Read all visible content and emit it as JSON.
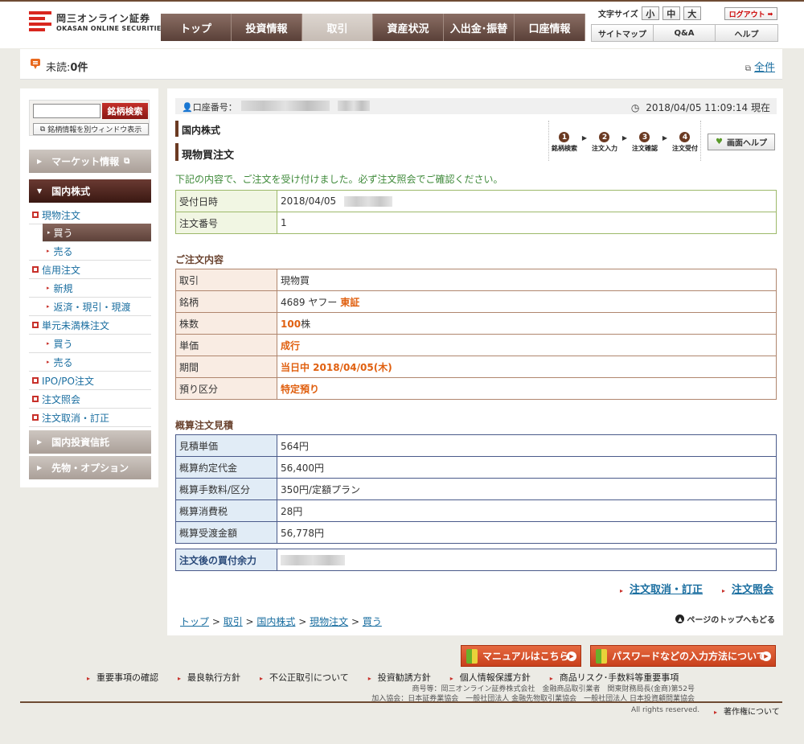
{
  "header": {
    "logo_ja": "岡三オンライン証券",
    "logo_en": "OKASAN ONLINE SECURITIES",
    "nav": [
      "トップ",
      "投資情報",
      "取引",
      "資産状況",
      "入出金･振替",
      "口座情報"
    ],
    "font_size_label": "文字サイズ",
    "font_sizes": [
      "小",
      "中",
      "大"
    ],
    "logout": "ログアウト",
    "subnav": [
      "サイトマップ",
      "Q&A",
      "ヘルプ"
    ]
  },
  "unread": {
    "label": "未読:",
    "count": "0件",
    "all": "全件"
  },
  "sidebar": {
    "search_button": "銘柄検索",
    "open_window": "銘柄情報を別ウィンドウ表示",
    "market_info": "マーケット情報",
    "domestic": "国内株式",
    "items": {
      "spot": "現物注文",
      "buy": "買う",
      "sell": "売る",
      "margin": "信用注文",
      "new": "新規",
      "repay": "返済・現引・現渡",
      "odd": "単元未満株注文",
      "odd_buy": "買う",
      "odd_sell": "売る",
      "ipo": "IPO/PO注文",
      "inquiry": "注文照会",
      "cancel": "注文取消・訂正"
    },
    "funds": "国内投資信託",
    "futures": "先物・オプション"
  },
  "main": {
    "account_label": "口座番号：",
    "datetime": "2018/04/05 11:09:14 現在",
    "title1": "国内株式",
    "title2": "現物買注文",
    "steps": [
      {
        "n": "1",
        "label": "銘柄検索"
      },
      {
        "n": "2",
        "label": "注文入力"
      },
      {
        "n": "3",
        "label": "注文確認"
      },
      {
        "n": "4",
        "label": "注文受付"
      }
    ],
    "help_button": "画面ヘルプ",
    "message": "下記の内容で、ご注文を受け付けました。必ず注文照会でご確認ください。",
    "receipt": {
      "date_label": "受付日時",
      "date_value": "2018/04/05",
      "no_label": "注文番号",
      "no_value": "1"
    },
    "order_title": "ご注文内容",
    "order": {
      "trade_label": "取引",
      "trade_value": "現物買",
      "stock_label": "銘柄",
      "stock_code_name": "4689 ヤフー",
      "stock_market": "東証",
      "qty_label": "株数",
      "qty_value": "100",
      "qty_unit": "株",
      "price_label": "単価",
      "price_value": "成行",
      "period_label": "期間",
      "period_value": "当日中 2018/04/05(木)",
      "deposit_label": "預り区分",
      "deposit_value": "特定預り"
    },
    "estimate_title": "概算注文見積",
    "estimate": {
      "unit_label": "見積単価",
      "unit_value": "564円",
      "amount_label": "概算約定代金",
      "amount_value": "56,400円",
      "fee_label": "概算手数料/区分",
      "fee_value": "350円/定額プラン",
      "tax_label": "概算消費税",
      "tax_value": "28円",
      "total_label": "概算受渡金額",
      "total_value": "56,778円"
    },
    "capacity_label": "注文後の買付余力",
    "link_cancel": "注文取消・訂正",
    "link_inquiry": "注文照会",
    "breadcrumb": [
      "トップ",
      "取引",
      "国内株式",
      "現物注文",
      "買う"
    ],
    "page_top": "ページのトップへもどる"
  },
  "footer": {
    "manual_button": "マニュアルはこちら",
    "password_button": "パスワードなどの入力方法について",
    "links": [
      "重要事項の確認",
      "最良執行方針",
      "不公正取引について",
      "投資勧誘方針",
      "個人情報保護方針",
      "商品リスク･手数料等重要事項"
    ],
    "company": "商号等：岡三オンライン証券株式会社　金融商品取引業者　関東財務局長(金商)第52号",
    "associations": "加入協会：日本証券業協会　一般社団法人 金融先物取引業協会　一般社団法人 日本投資顧問業協会",
    "copyright": "All rights reserved.",
    "copyright_link": "著作権について"
  }
}
